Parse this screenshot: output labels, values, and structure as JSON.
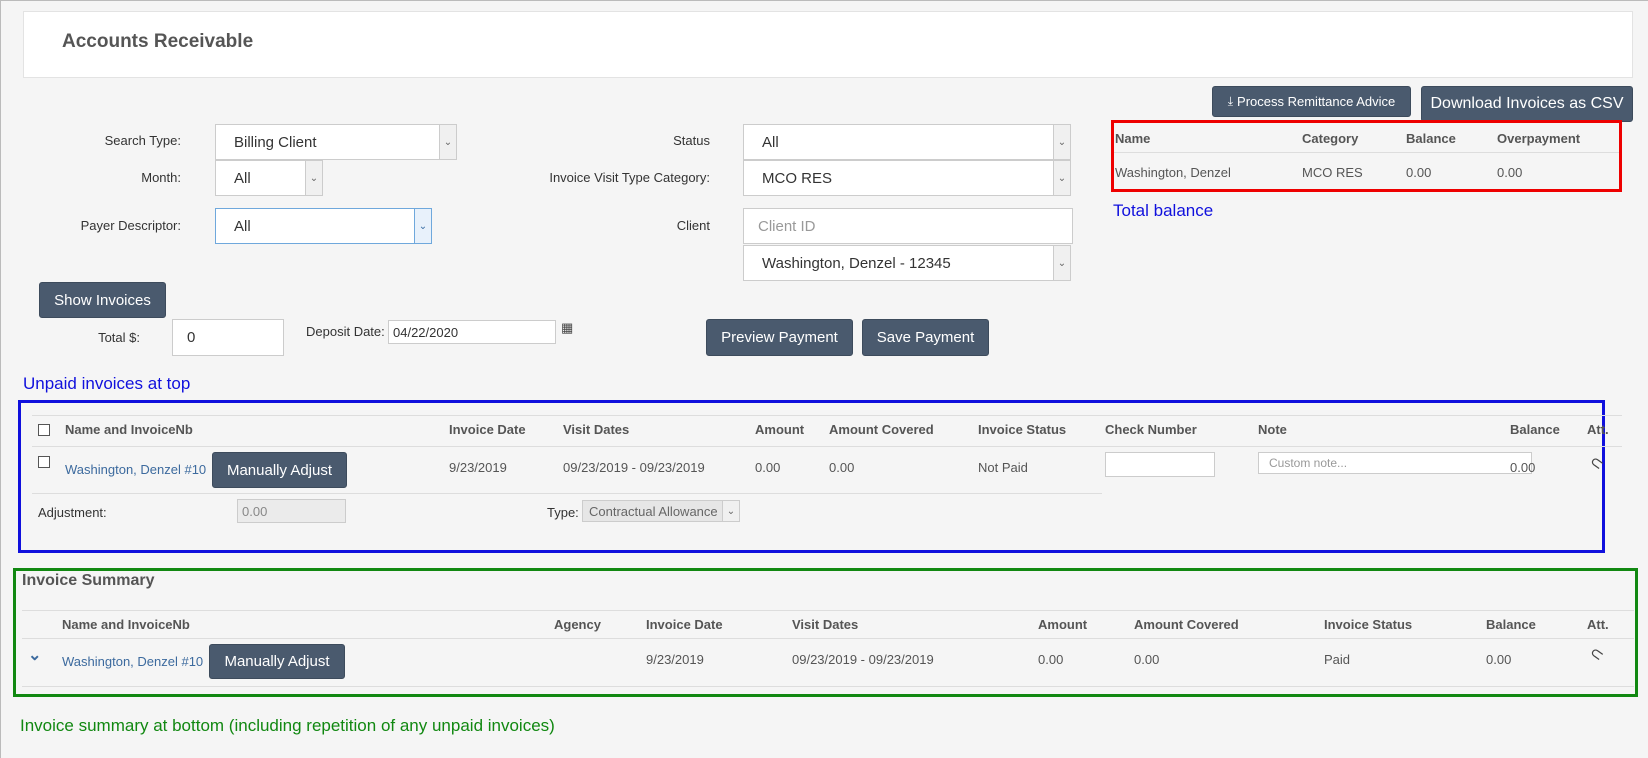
{
  "header": {
    "title": "Accounts Receivable"
  },
  "actions": {
    "process_remittance": "Process Remittance Advice",
    "download_csv": "Download Invoices as CSV"
  },
  "filters": {
    "search_type_label": "Search Type:",
    "search_type_value": "Billing Client",
    "month_label": "Month:",
    "month_value": "All",
    "payer_label": "Payer Descriptor:",
    "payer_value": "All",
    "status_label": "Status",
    "status_value": "All",
    "visit_type_label": "Invoice Visit Type Category:",
    "visit_type_value": "MCO RES",
    "client_label": "Client",
    "client_id_placeholder": "Client ID",
    "client_value": "Washington, Denzel - 12345"
  },
  "balance_table": {
    "headers": [
      "Name",
      "Category",
      "Balance",
      "Overpayment"
    ],
    "row": [
      "Washington, Denzel",
      "MCO RES",
      "0.00",
      "0.00"
    ]
  },
  "payment": {
    "show_invoices": "Show Invoices",
    "total_label": "Total $:",
    "total_value": "0",
    "deposit_label": "Deposit Date:",
    "deposit_value": "04/22/2020",
    "preview": "Preview Payment",
    "save": "Save Payment"
  },
  "unpaid_table": {
    "headers": {
      "name": "Name and InvoiceNb",
      "invoice_date": "Invoice Date",
      "visit_dates": "Visit Dates",
      "amount": "Amount",
      "amount_covered": "Amount Covered",
      "status": "Invoice Status",
      "check_number": "Check Number",
      "note": "Note",
      "balance": "Balance",
      "att": "Att."
    },
    "row": {
      "name": "Washington, Denzel #10",
      "adjust": "Manually Adjust",
      "invoice_date": "9/23/2019",
      "visit_dates": "09/23/2019 - 09/23/2019",
      "amount": "0.00",
      "amount_covered": "0.00",
      "status": "Not Paid",
      "note_placeholder": "Custom note...",
      "balance": "0.00"
    },
    "adjustment_label": "Adjustment:",
    "adjustment_value": "0.00",
    "type_label": "Type:",
    "type_value": "Contractual Allowance"
  },
  "summary": {
    "title": "Invoice Summary",
    "headers": {
      "name": "Name and InvoiceNb",
      "agency": "Agency",
      "invoice_date": "Invoice Date",
      "visit_dates": "Visit Dates",
      "amount": "Amount",
      "amount_covered": "Amount Covered",
      "status": "Invoice Status",
      "balance": "Balance",
      "att": "Att."
    },
    "row": {
      "name": "Washington, Denzel #10",
      "adjust": "Manually Adjust",
      "invoice_date": "9/23/2019",
      "visit_dates": "09/23/2019 - 09/23/2019",
      "amount": "0.00",
      "amount_covered": "0.00",
      "status": "Paid",
      "balance": "0.00"
    }
  },
  "annotations": {
    "total_balance": "Total balance",
    "unpaid_top": "Unpaid invoices at top",
    "summary_bottom": "Invoice summary at bottom (including repetition of any unpaid invoices)"
  },
  "colors": {
    "annotation_red": "#ee0000",
    "annotation_blue": "#1010dd",
    "annotation_green": "#118811",
    "button_bg": "#4a5a6e",
    "link": "#3c6a9e"
  }
}
